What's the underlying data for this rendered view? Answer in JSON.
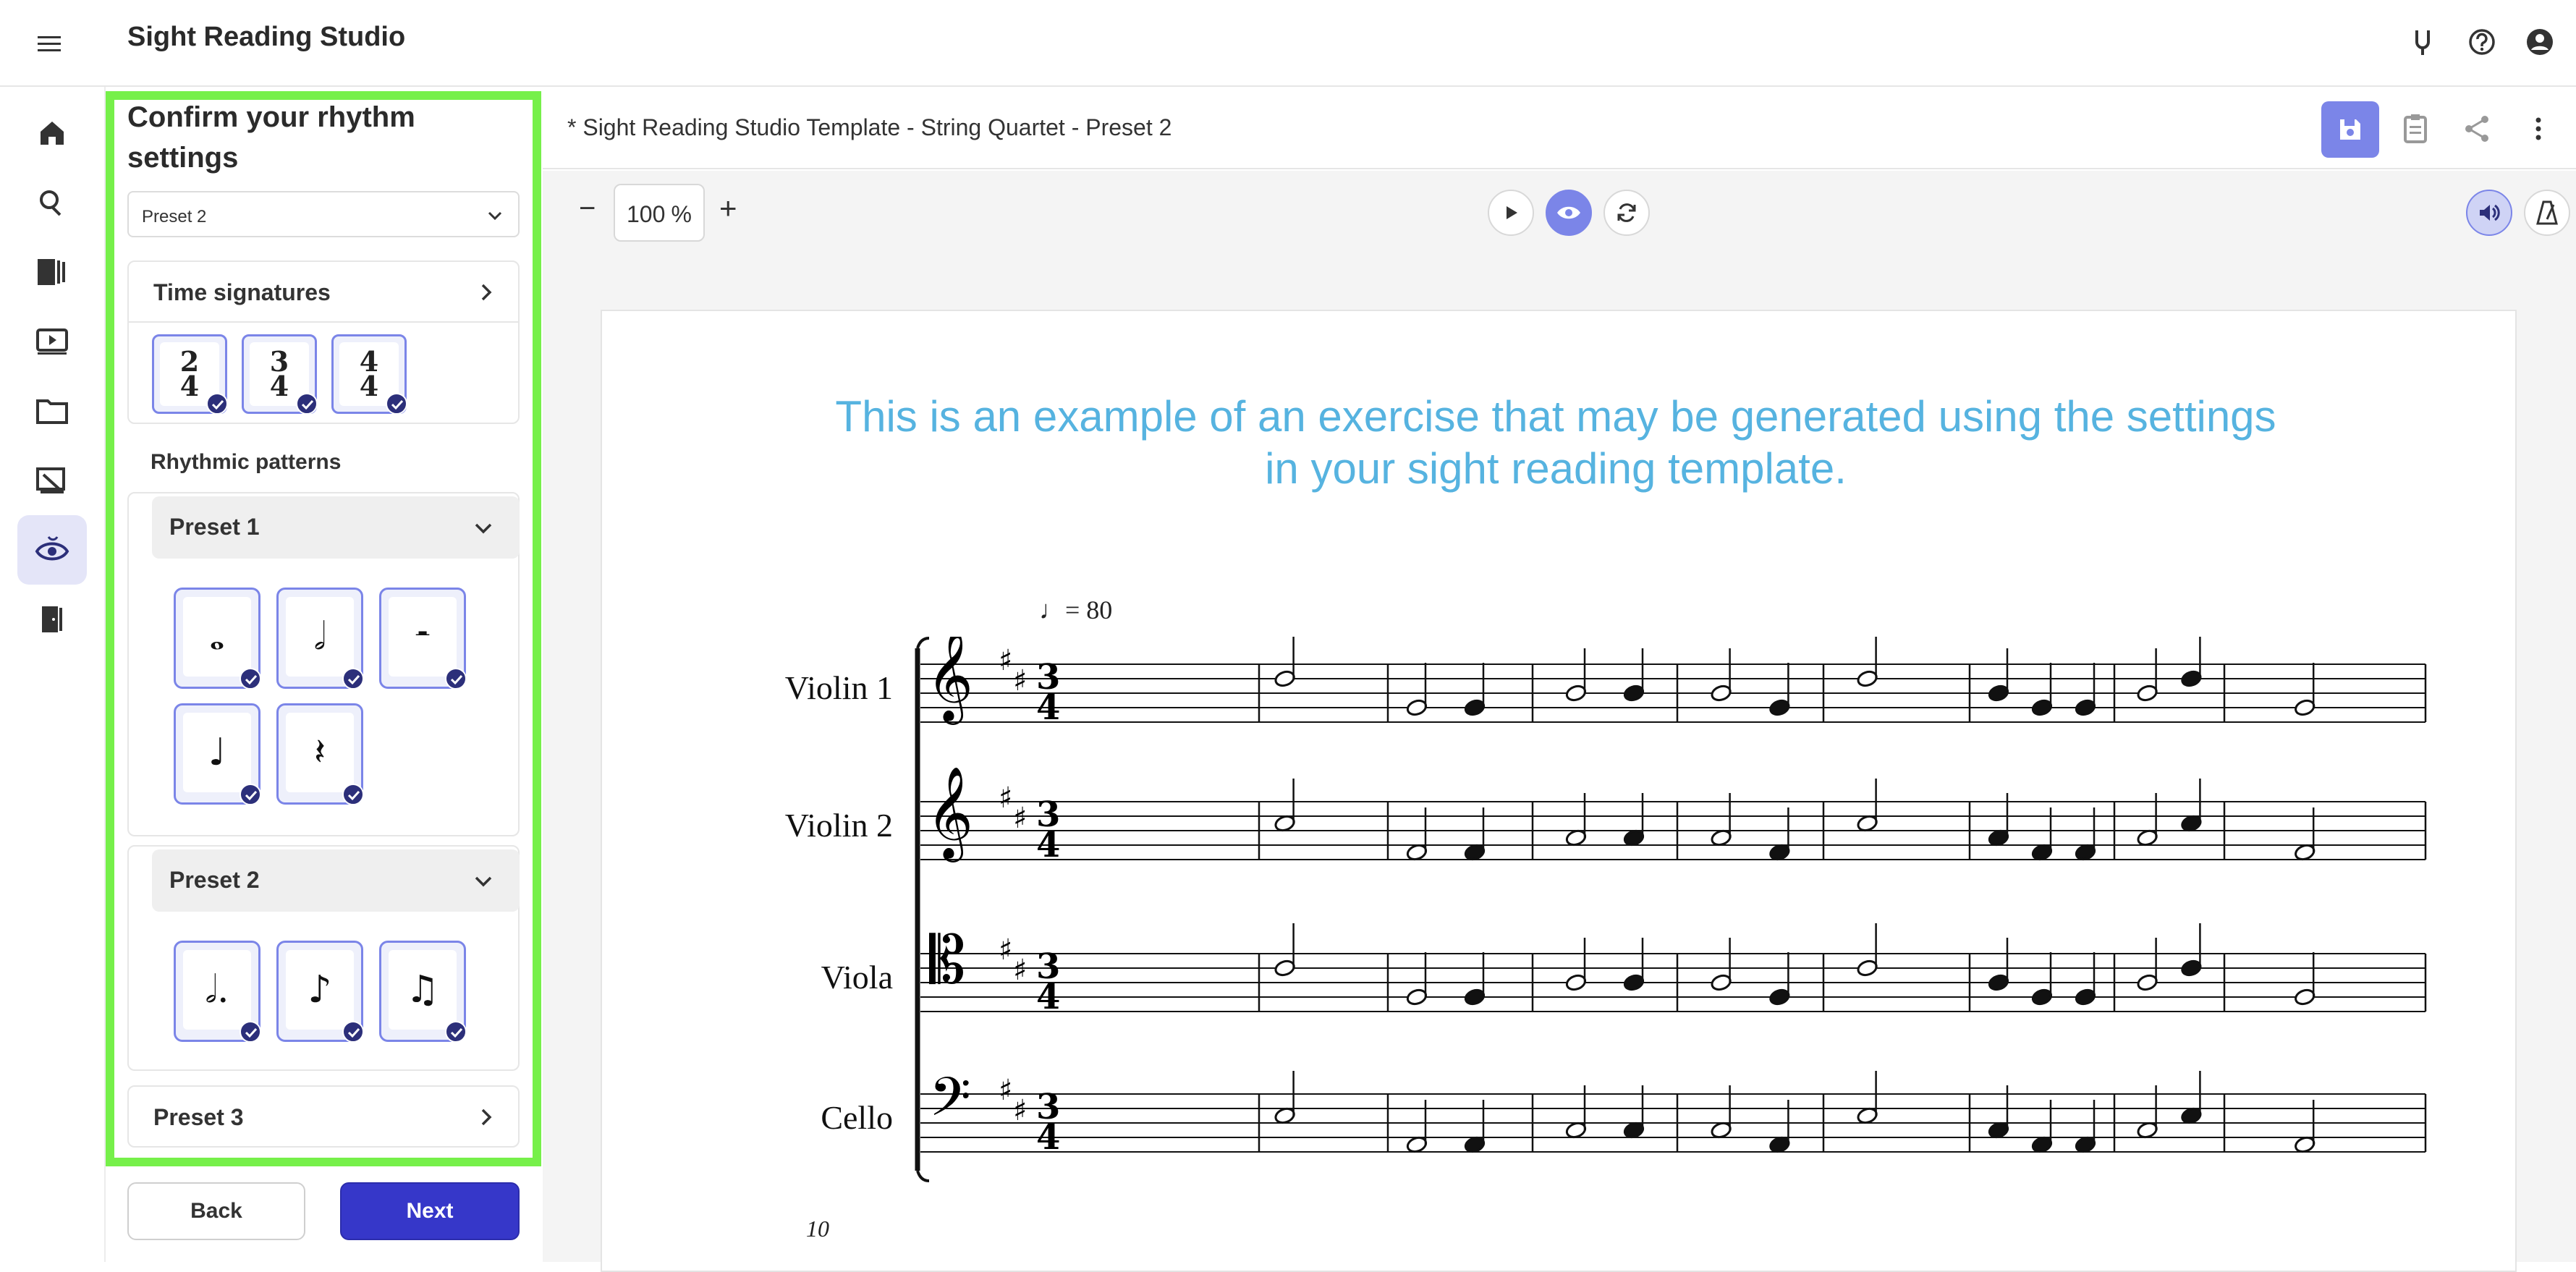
{
  "app": {
    "title": "Sight Reading Studio"
  },
  "top_icons": [
    "tuning-fork-icon",
    "help-icon",
    "account-icon"
  ],
  "rail": {
    "items": [
      "home-icon",
      "search-icon",
      "library-icon",
      "video-icon",
      "folder-icon",
      "assignment-icon",
      "sight-reading-icon",
      "exit-icon"
    ],
    "active_index": 6
  },
  "panel": {
    "heading": "Confirm your rhythm settings",
    "preset_select": "Preset 2",
    "time_signatures": {
      "title": "Time signatures",
      "items": [
        {
          "top": "2",
          "bottom": "4"
        },
        {
          "top": "3",
          "bottom": "4"
        },
        {
          "top": "4",
          "bottom": "4"
        }
      ]
    },
    "rhythmic_patterns_title": "Rhythmic patterns",
    "presets": [
      {
        "label": "Preset 1",
        "expanded": true,
        "items": [
          "𝅝",
          "𝅗𝅥",
          "𝄼",
          "♩",
          "𝄽"
        ]
      },
      {
        "label": "Preset 2",
        "expanded": true,
        "items": [
          "𝅗𝅥.",
          "♪",
          "♫"
        ]
      },
      {
        "label": "Preset 3",
        "expanded": false
      }
    ],
    "back_label": "Back",
    "next_label": "Next"
  },
  "document": {
    "title": "* Sight Reading Studio Template - String Quartet - Preset 2",
    "zoom_value": "100",
    "zoom_unit": "%",
    "zoom_minus": "−",
    "zoom_plus": "+",
    "notice": "This is an example of an exercise that may be generated using the settings in your sight reading template.",
    "tempo": "♩= 80",
    "staves": [
      "Violin 1",
      "Violin 2",
      "Viola",
      "Cello"
    ],
    "measure_number": "10",
    "time_signature": {
      "top": "3",
      "bottom": "4"
    }
  },
  "colors": {
    "panel_highlight": "#76f04a",
    "accent": "#7b85e8",
    "primary_button": "#3637c9",
    "notice_text": "#56b3e0"
  }
}
